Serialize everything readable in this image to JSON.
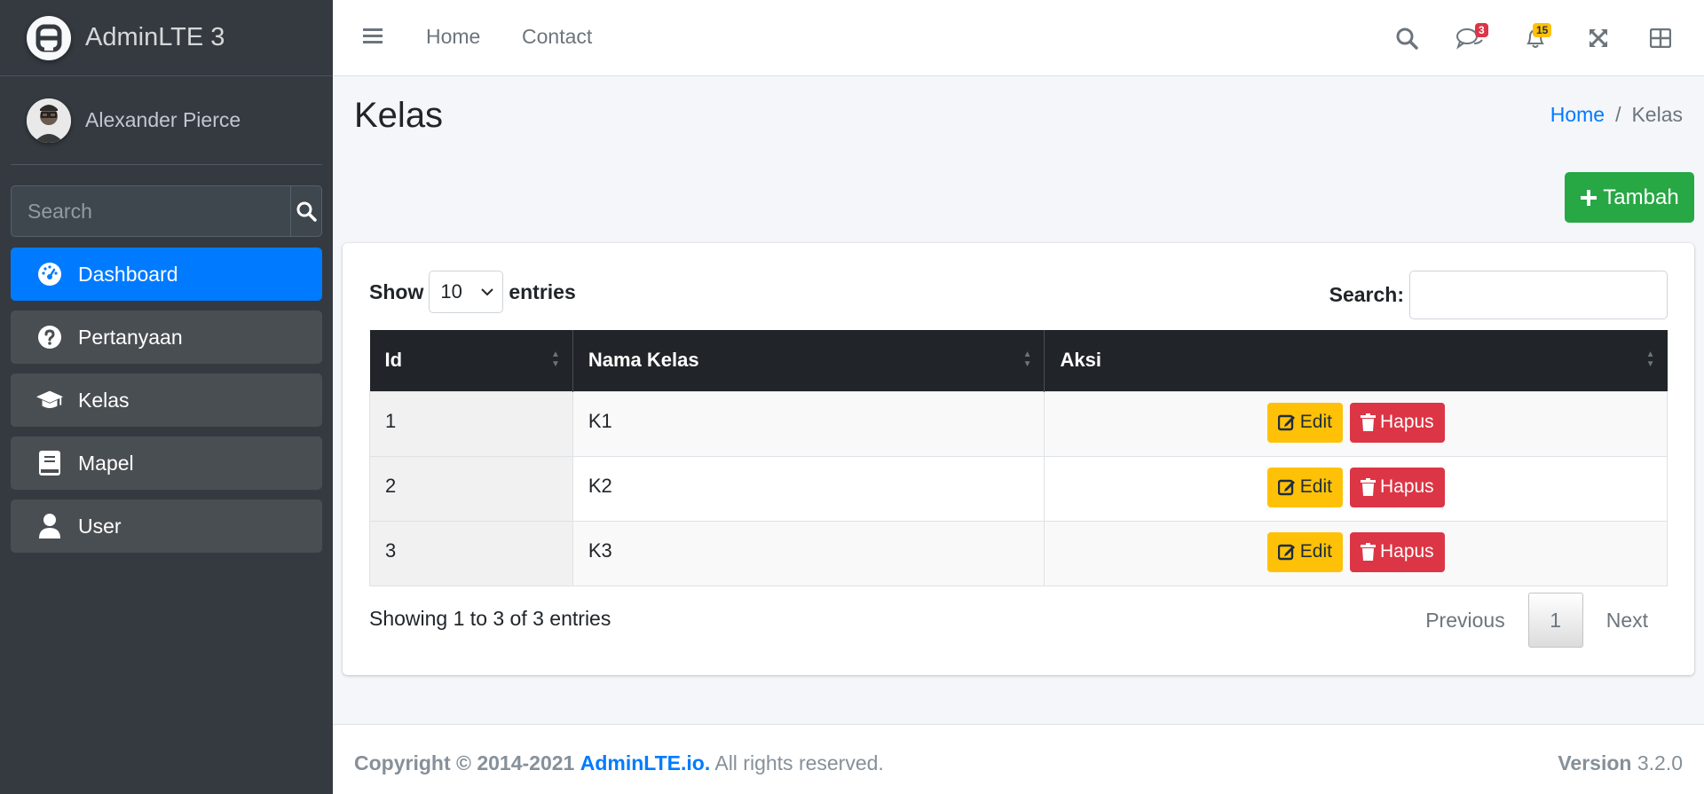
{
  "brand": {
    "name": "AdminLTE 3"
  },
  "user": {
    "name": "Alexander Pierce"
  },
  "sidebar": {
    "search_placeholder": "Search",
    "items": [
      {
        "label": "Dashboard",
        "icon": "tachometer-icon",
        "active": true
      },
      {
        "label": "Pertanyaan",
        "icon": "question-circle-icon",
        "active": false
      },
      {
        "label": "Kelas",
        "icon": "graduation-cap-icon",
        "active": false
      },
      {
        "label": "Mapel",
        "icon": "book-icon",
        "active": false
      },
      {
        "label": "User",
        "icon": "user-icon",
        "active": false
      }
    ]
  },
  "navbar": {
    "home": "Home",
    "contact": "Contact",
    "messages_badge": "3",
    "notifications_badge": "15"
  },
  "page": {
    "title": "Kelas",
    "breadcrumb": {
      "home": "Home",
      "separator": "/",
      "current": "Kelas"
    },
    "add_button": "Tambah"
  },
  "table_controls": {
    "show_label": "Show",
    "length_value": "10",
    "entries_label": "entries",
    "search_label": "Search:"
  },
  "table": {
    "headers": [
      "Id",
      "Nama Kelas",
      "Aksi"
    ],
    "rows": [
      {
        "id": "1",
        "nama": "K1"
      },
      {
        "id": "2",
        "nama": "K2"
      },
      {
        "id": "3",
        "nama": "K3"
      }
    ],
    "edit_label": "Edit",
    "delete_label": "Hapus"
  },
  "pagination": {
    "info": "Showing 1 to 3 of 3 entries",
    "previous": "Previous",
    "page": "1",
    "next": "Next"
  },
  "footer": {
    "copyright": "Copyright © 2014-2021",
    "brand_link": "AdminLTE.io.",
    "rights": "All rights reserved.",
    "version_label": "Version",
    "version": "3.2.0"
  },
  "colors": {
    "sidebar_bg": "#343a40",
    "primary": "#007bff",
    "success": "#28a745",
    "warning": "#ffc107",
    "danger": "#dc3545",
    "table_head": "#212529"
  }
}
